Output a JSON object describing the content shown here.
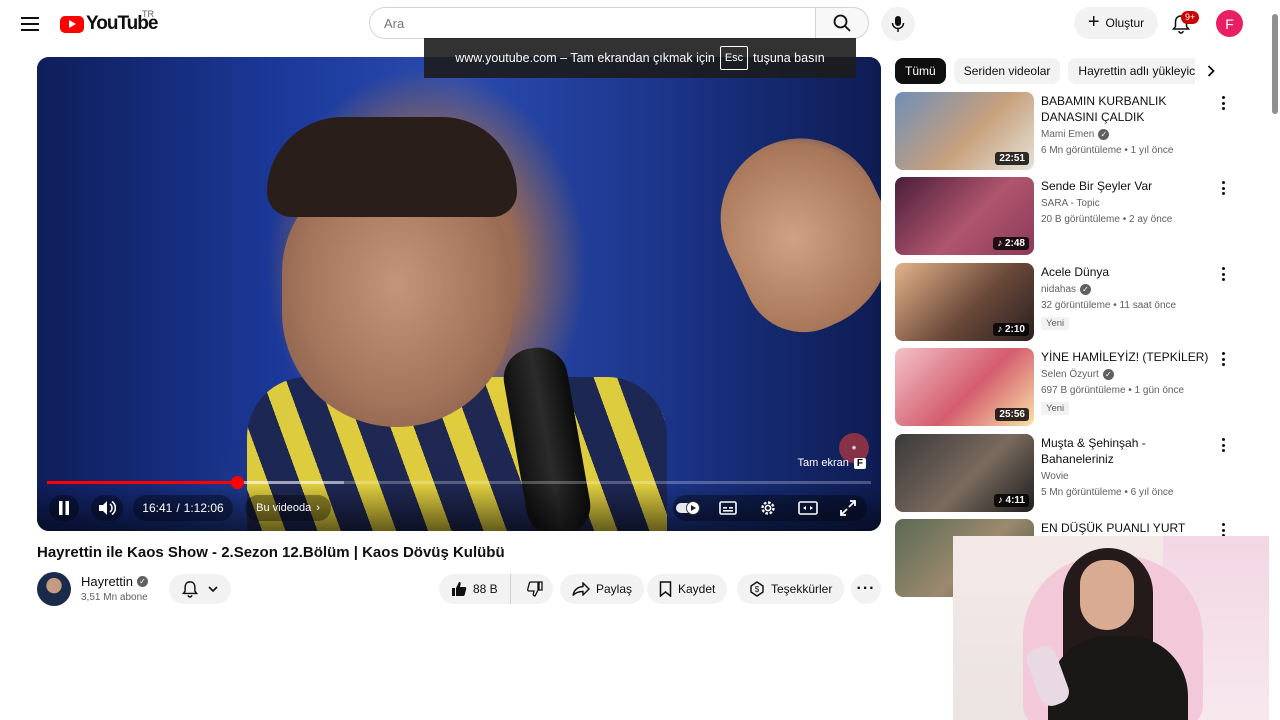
{
  "header": {
    "logo_text": "YouTube",
    "region": "TR",
    "search_placeholder": "Ara",
    "create_label": "Oluştur",
    "notification_badge": "9+",
    "avatar_letter": "F"
  },
  "fullscreen_toast": {
    "prefix": "www.youtube.com – Tam ekrandan çıkmak için",
    "key": "Esc",
    "suffix": "tuşuna basın"
  },
  "player": {
    "fullscreen_hint": "Tam ekran",
    "fullscreen_key": "F",
    "time_current": "16:41",
    "time_separator": "/",
    "time_total": "1:12:06",
    "chapter_label": "Bu videoda",
    "progress_played_fraction": 0.231,
    "progress_buffered_fraction": 0.36
  },
  "video": {
    "title": "Hayrettin ile Kaos Show - 2.Sezon 12.Bölüm | Kaos Dövüş Kulübü",
    "channel_name": "Hayrettin",
    "subscribers": "3,51 Mn abone",
    "like_count": "88 B",
    "share_label": "Paylaş",
    "save_label": "Kaydet",
    "thanks_label": "Teşekkürler"
  },
  "chips": [
    "Tümü",
    "Seriden videolar",
    "Hayrettin adlı yükleyici"
  ],
  "recommendations": [
    {
      "title": "BABAMIN KURBANLIK DANASINI ÇALDIK",
      "channel": "Mami Emen",
      "verified": true,
      "meta": "6 Mn görüntüleme • 1 yıl önce",
      "duration": "22:51",
      "badge": "",
      "thumb_colors": [
        "#6f8fb8",
        "#c7a07c",
        "#e6e2da"
      ]
    },
    {
      "title": "Sende Bir Şeyler Var",
      "channel": "SARA - Topic",
      "verified": false,
      "meta": "20 B görüntüleme • 2 ay önce",
      "duration": "♪ 2:48",
      "badge": "",
      "thumb_colors": [
        "#4a1e3a",
        "#b0556e",
        "#8a3a5a"
      ]
    },
    {
      "title": "Acele Dünya",
      "channel": "nidahas",
      "verified": true,
      "meta": "32 görüntüleme • 11 saat önce",
      "duration": "♪ 2:10",
      "badge": "Yeni",
      "thumb_colors": [
        "#e3b48b",
        "#6d4a3a",
        "#2a2020"
      ]
    },
    {
      "title": "YİNE HAMİLEYİZ! (TEPKİLER)",
      "channel": "Selen Özyurt",
      "verified": true,
      "meta": "697 B görüntüleme • 1 gün önce",
      "duration": "25:56",
      "badge": "Yeni",
      "thumb_colors": [
        "#f2c2c8",
        "#d45c6e",
        "#f7e3a6"
      ]
    },
    {
      "title": "Muşta & Şehinşah - Bahaneleriniz",
      "channel": "Wovie",
      "verified": false,
      "meta": "5 Mn görüntüleme • 6 yıl önce",
      "duration": "♪ 4:11",
      "badge": "",
      "thumb_colors": [
        "#3a3a3a",
        "#7a6a5e",
        "#1e1e1e"
      ]
    },
    {
      "title": "EN DÜŞÜK PUANLI YURT DIŞI",
      "channel": "",
      "verified": false,
      "meta": "",
      "duration": "",
      "badge": "",
      "thumb_colors": [
        "#5a6a52",
        "#9c8a6e",
        "#3a4a3a"
      ]
    }
  ]
}
